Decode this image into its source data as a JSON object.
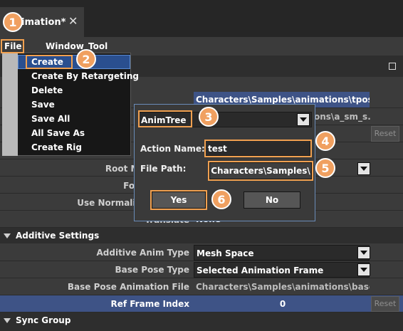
{
  "tab": {
    "title": "Animation*",
    "visible_title": "imation*"
  },
  "menu": {
    "file": "File",
    "window": "Window",
    "tool": "Tool"
  },
  "file_menu": {
    "items": [
      "Create",
      "Create By Retargeting",
      "Delete",
      "Save",
      "Save All",
      "All Save As",
      "Create Rig"
    ]
  },
  "callouts": [
    "1",
    "2",
    "3",
    "4",
    "5",
    "6"
  ],
  "dialog": {
    "type_value": "AnimTree",
    "action_name_label": "Action Name:",
    "action_name_value": "test",
    "file_path_label": "File Path:",
    "file_path_value": "Characters\\Samples\\",
    "yes_label": "Yes",
    "no_label": "No"
  },
  "properties": {
    "row1_value": "Characters\\Samples\\animations\\tpose.x...",
    "row2_value": "ons\\a_sm_s...",
    "root_motion_root_label": "Root Motion Root",
    "force_root_lock_label": "Force Root Lo",
    "use_normalized_root_label": "Use Normalized Root M",
    "translate_label": "Translate",
    "translate_value": "None",
    "reset_label": "Reset"
  },
  "additive": {
    "section_title": "Additive Settings",
    "rows": [
      {
        "label": "Additive Anim Type",
        "value": "Mesh Space"
      },
      {
        "label": "Base Pose Type",
        "value": "Selected Animation Frame"
      },
      {
        "label": "Base Pose Animation File",
        "value": "Characters\\Samples\\animations\\base_s..."
      },
      {
        "label": "Ref Frame Index",
        "value": "0"
      }
    ]
  },
  "sync": {
    "section_title": "Sync Group"
  },
  "colors": {
    "accent": "#f0a060",
    "selection": "#2a4f8f",
    "dialog_border": "#6a8cb8"
  }
}
